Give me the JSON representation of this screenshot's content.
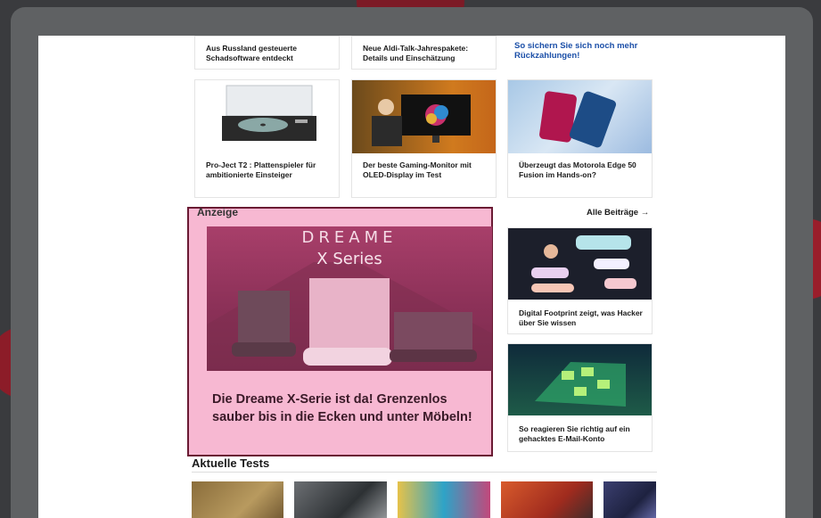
{
  "top_row": [
    {
      "caption": "Aus Russland gesteuerte Schadsoftware entdeckt"
    },
    {
      "caption": "Neue Aldi-Talk-Jahrespakete: Details und Einschätzung"
    },
    {
      "caption": "So sichern Sie sich noch mehr Rückzahlungen!"
    }
  ],
  "second_row": [
    {
      "caption": "Pro-Ject T2 : Plattenspieler für ambitionierte Einsteiger"
    },
    {
      "caption": "Der beste Gaming-Monitor mit OLED-Display im Test"
    },
    {
      "caption": "Überzeugt das Motorola Edge 50 Fusion im Hands-on?"
    }
  ],
  "ad_section": {
    "label": "Anzeige",
    "all_posts": "Alle Beiträge →",
    "brand": "DREAME",
    "series": "X Series",
    "headline": "Die Dreame X-Serie ist da! Grenzenlos sauber bis in die Ecken und unter Möbeln!"
  },
  "side_articles": [
    {
      "caption": "Digital Footprint zeigt, was Hacker über Sie wissen"
    },
    {
      "caption": "So reagieren Sie richtig auf ein gehacktes E-Mail-Konto"
    }
  ],
  "tests_section": {
    "title": "Aktuelle Tests"
  },
  "colors": {
    "ad_highlight": "#f7b8d2",
    "ad_border": "#6a1a33",
    "link_blue": "#1b4fa8"
  }
}
